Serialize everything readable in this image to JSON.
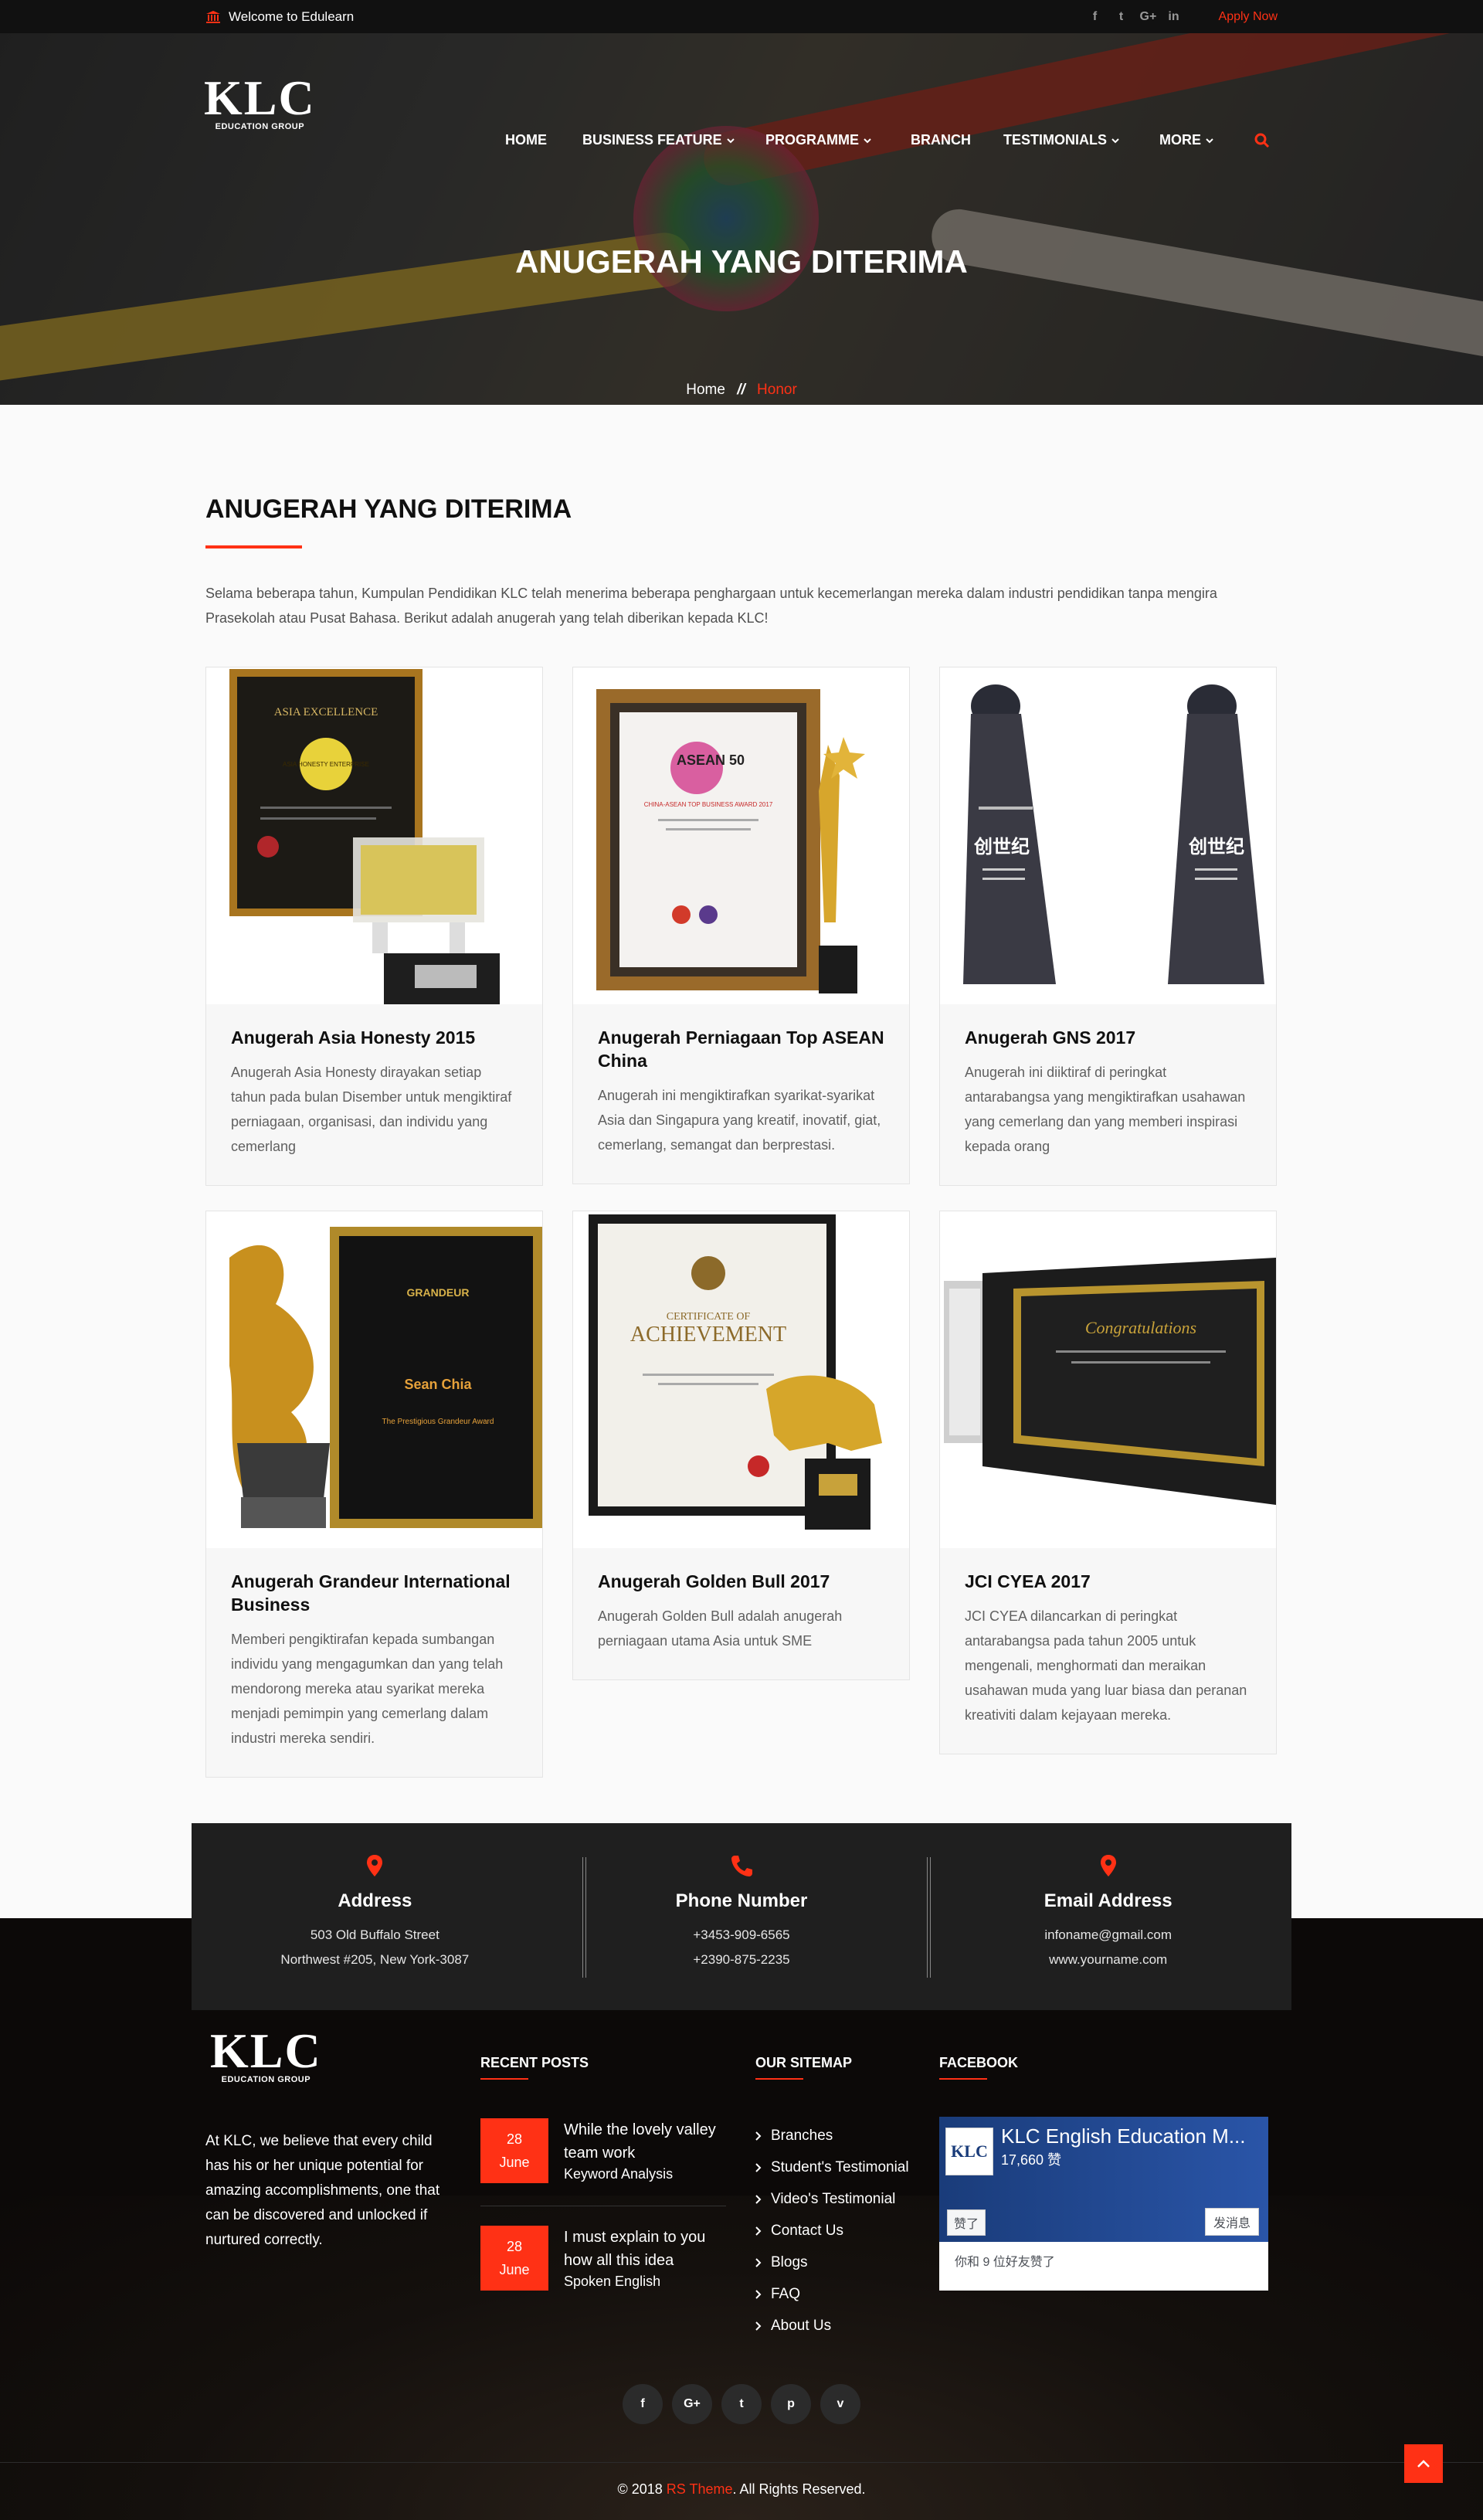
{
  "topbar": {
    "welcome": "Welcome to Edulearn",
    "social": [
      "f",
      "t",
      "G+",
      "in"
    ],
    "apply": "Apply Now"
  },
  "logo": {
    "text": "KLC",
    "sub": "EDUCATION GROUP"
  },
  "nav": {
    "items": [
      "HOME",
      "BUSINESS FEATURE",
      "PROGRAMME",
      "BRANCH",
      "TESTIMONIALS",
      "MORE"
    ],
    "dropdown": [
      false,
      true,
      true,
      false,
      true,
      true
    ]
  },
  "hero": {
    "title": "ANUGERAH YANG DITERIMA"
  },
  "breadcrumb": {
    "home": "Home",
    "sep": "//",
    "current": "Honor"
  },
  "section": {
    "title": "ANUGERAH YANG DITERIMA",
    "intro": "Selama beberapa tahun, Kumpulan Pendidikan KLC telah menerima beberapa penghargaan untuk kecemerlangan mereka dalam industri pendidikan tanpa mengira Prasekolah atau Pusat Bahasa. Berikut adalah anugerah yang telah diberikan kepada KLC!"
  },
  "awards": [
    {
      "title": "Anugerah Asia Honesty 2015",
      "desc": "Anugerah Asia Honesty dirayakan setiap tahun pada bulan Disember untuk mengiktiraf perniagaan, organisasi, dan individu yang cemerlang"
    },
    {
      "title": "Anugerah Perniagaan Top ASEAN China",
      "desc": "Anugerah ini mengiktirafkan syarikat-syarikat Asia dan Singapura yang kreatif, inovatif, giat, cemerlang, semangat dan berprestasi."
    },
    {
      "title": "Anugerah GNS 2017",
      "desc": "Anugerah ini diiktiraf di peringkat antarabangsa yang mengiktirafkan usahawan yang cemerlang dan yang memberi inspirasi kepada orang"
    },
    {
      "title": "Anugerah Grandeur International Business",
      "desc": "Memberi pengiktirafan kepada sumbangan individu yang mengagumkan dan yang telah mendorong mereka atau syarikat mereka menjadi pemimpin yang cemerlang dalam industri mereka sendiri."
    },
    {
      "title": "Anugerah Golden Bull 2017",
      "desc": "Anugerah Golden Bull adalah anugerah perniagaan utama Asia untuk SME"
    },
    {
      "title": "JCI CYEA 2017",
      "desc": "JCI CYEA dilancarkan di peringkat antarabangsa pada tahun 2005 untuk mengenali, menghormati dan meraikan usahawan muda yang luar biasa dan peranan kreativiti dalam kejayaan mereka."
    }
  ],
  "award_images": {
    "certificate_1": [
      "ASIA EXCELLENCE",
      "ASIA HONESTY ENTERPRISE"
    ],
    "certificate_2": [
      "ASEAN 50",
      "CHINA-ASEAN TOP BUSINESS AWARD 2017"
    ],
    "trophy_3": [
      "创世纪"
    ],
    "certificate_4": [
      "GRANDEUR",
      "Sean Chia",
      "The Prestigious Grandeur Award"
    ],
    "certificate_5": [
      "CERTIFICATE OF",
      "ACHIEVEMENT"
    ],
    "certificate_6": [
      "Congratulations"
    ]
  },
  "contact": [
    {
      "title": "Address",
      "lines": [
        "503 Old Buffalo Street",
        "Northwest #205, New York-3087"
      ],
      "icon": "map-pin-icon"
    },
    {
      "title": "Phone Number",
      "lines": [
        "+3453-909-6565",
        "+2390-875-2235"
      ],
      "icon": "phone-icon"
    },
    {
      "title": "Email Address",
      "lines": [
        "infoname@gmail.com",
        "www.yourname.com"
      ],
      "icon": "map-pin-icon"
    }
  ],
  "footer": {
    "about": "At KLC, we believe that every child has his or her unique potential for amazing accomplishments, one that can be discovered and unlocked if nurtured correctly.",
    "recent_title": "RECENT POSTS",
    "posts": [
      {
        "day": "28",
        "month": "June",
        "title": "While the lovely valley team work",
        "cat": "Keyword Analysis"
      },
      {
        "day": "28",
        "month": "June",
        "title": "I must explain to you how all this idea",
        "cat": "Spoken English"
      }
    ],
    "sitemap_title": "OUR SITEMAP",
    "sitemap": [
      "Branches",
      "Student's Testimonial",
      "Video's Testimonial",
      "Contact Us",
      "Blogs",
      "FAQ",
      "About Us"
    ],
    "facebook_title": "FACEBOOK",
    "fb": {
      "page": "KLC English Education M...",
      "likes": "17,660 赞",
      "like_btn": "赞了",
      "msg_btn": "发消息",
      "friends": "你和 9 位好友赞了",
      "thumb": "KLC"
    },
    "social": [
      "f",
      "G+",
      "t",
      "p",
      "v"
    ],
    "copyright_pre": "© 2018 ",
    "copyright_brand": "RS Theme",
    "copyright_post": ". All Rights Reserved."
  },
  "colors": {
    "accent": "#ff3115",
    "dark": "#111111",
    "footer": "#0c0908",
    "contact_bg": "#1f1f1f"
  }
}
